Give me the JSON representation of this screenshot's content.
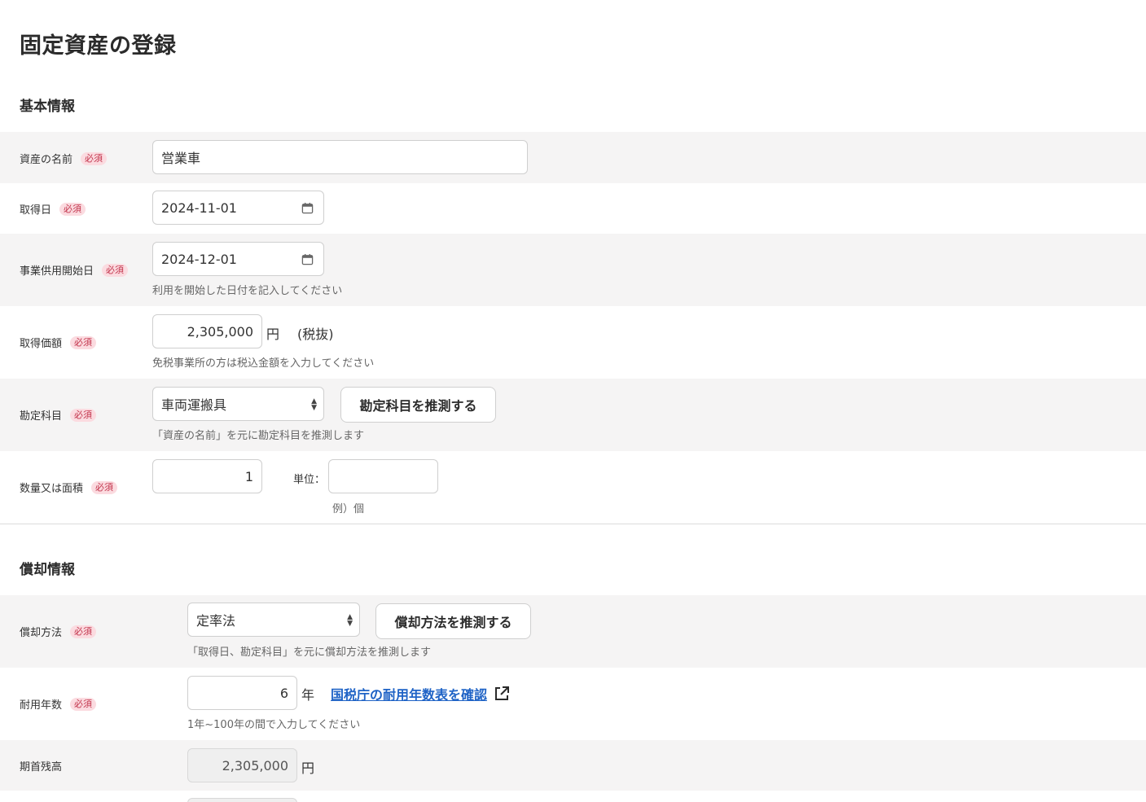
{
  "page_title": "固定資産の登録",
  "sections": {
    "basic": "基本情報",
    "depreciation": "償却情報"
  },
  "required_badge": "必須",
  "fields": {
    "asset_name": {
      "label": "資産の名前",
      "value": "営業車"
    },
    "acquisition_date": {
      "label": "取得日",
      "value": "2024-11-01"
    },
    "service_start_date": {
      "label": "事業供用開始日",
      "value": "2024-12-01",
      "hint": "利用を開始した日付を記入してください"
    },
    "acquisition_price": {
      "label": "取得価額",
      "value": "2,305,000",
      "unit": "円",
      "tax_note": "(税抜)",
      "hint": "免税事業所の方は税込金額を入力してください"
    },
    "account_title": {
      "label": "勘定科目",
      "value": "車両運搬具",
      "button": "勘定科目を推測する",
      "hint": "「資産の名前」を元に勘定科目を推測します"
    },
    "quantity": {
      "label": "数量又は面積",
      "value": "1",
      "unit_label": "単位：",
      "unit_value": "",
      "unit_hint": "例）個"
    },
    "depreciation_method": {
      "label": "償却方法",
      "value": "定率法",
      "button": "償却方法を推測する",
      "hint": "「取得日、勘定科目」を元に償却方法を推測します"
    },
    "useful_life": {
      "label": "耐用年数",
      "value": "6",
      "unit": "年",
      "link": "国税庁の耐用年数表を確認",
      "hint": "1年~100年の間で入力してください"
    },
    "opening_balance": {
      "label": "期首残高",
      "value": "2,305,000",
      "unit": "円"
    }
  },
  "icons": {
    "calendar": "calendar-icon",
    "select": "select-arrows-icon",
    "external": "external-link-icon"
  }
}
